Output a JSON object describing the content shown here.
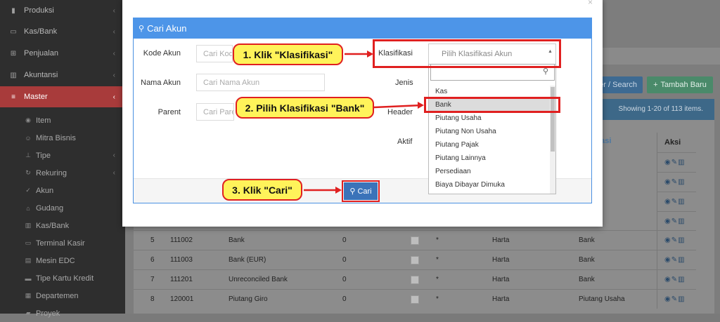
{
  "sidebar": {
    "items": [
      {
        "label": "Produksi",
        "icon": "bar-chart-icon"
      },
      {
        "label": "Kas/Bank",
        "icon": "money-icon"
      },
      {
        "label": "Penjualan",
        "icon": "cart-icon"
      },
      {
        "label": "Akuntansi",
        "icon": "chart-icon"
      },
      {
        "label": "Master",
        "icon": "database-icon"
      }
    ],
    "sub_items": [
      "Item",
      "Mitra Bisnis",
      "Tipe",
      "Rekuring",
      "Akun",
      "Gudang",
      "Kas/Bank",
      "Terminal Kasir",
      "Mesin EDC",
      "Tipe Kartu Kredit",
      "Departemen",
      "Proyek"
    ]
  },
  "toolbar": {
    "search_label": "er / Search",
    "add_label": "Tambah Baru",
    "showing_text": "Showing 1-20 of 113 items."
  },
  "table": {
    "headers": {
      "klasifikasi": "ikasi",
      "aksi": "Aksi"
    },
    "rows": [
      {
        "no": "5",
        "kode": "111002",
        "nama": "Bank",
        "saldo": "0",
        "jenis": "*",
        "tipe": "Harta",
        "klasifikasi": "Bank"
      },
      {
        "no": "6",
        "kode": "111003",
        "nama": "Bank (EUR)",
        "saldo": "0",
        "jenis": "*",
        "tipe": "Harta",
        "klasifikasi": "Bank"
      },
      {
        "no": "7",
        "kode": "111201",
        "nama": "Unreconciled Bank",
        "saldo": "0",
        "jenis": "*",
        "tipe": "Harta",
        "klasifikasi": "Bank"
      },
      {
        "no": "8",
        "kode": "120001",
        "nama": "Piutang Giro",
        "saldo": "0",
        "jenis": "*",
        "tipe": "Harta",
        "klasifikasi": "Piutang Usaha"
      }
    ]
  },
  "modal": {
    "title": "Cari Akun",
    "fields": {
      "kode_label": "Kode Akun",
      "kode_placeholder": "Cari Kode Akun",
      "nama_label": "Nama Akun",
      "nama_placeholder": "Cari Nama Akun",
      "parent_label": "Parent",
      "parent_placeholder": "Cari Parent",
      "klasifikasi_label": "Klasifikasi",
      "klasifikasi_placeholder": "Pilih Klasifikasi Akun",
      "jenis_label": "Jenis",
      "header_label": "Header",
      "aktif_label": "Aktif"
    },
    "cari_label": "Cari",
    "dropdown_options": [
      "Kas",
      "Bank",
      "Piutang Usaha",
      "Piutang Non Usaha",
      "Piutang Pajak",
      "Piutang Lainnya",
      "Persediaan",
      "Biaya Dibayar Dimuka"
    ],
    "selected_highlight": "Bank"
  },
  "callouts": {
    "step1": "1. Klik \"Klasifikasi\"",
    "step2": "2. Pilih Klasifikasi \"Bank\"",
    "step3": "3. Klik \"Cari\""
  },
  "colors": {
    "accent": "#4d95e8",
    "callout_bg": "#fff35a",
    "callout_border": "#e02020",
    "sidebar_active": "#a83b3b"
  }
}
